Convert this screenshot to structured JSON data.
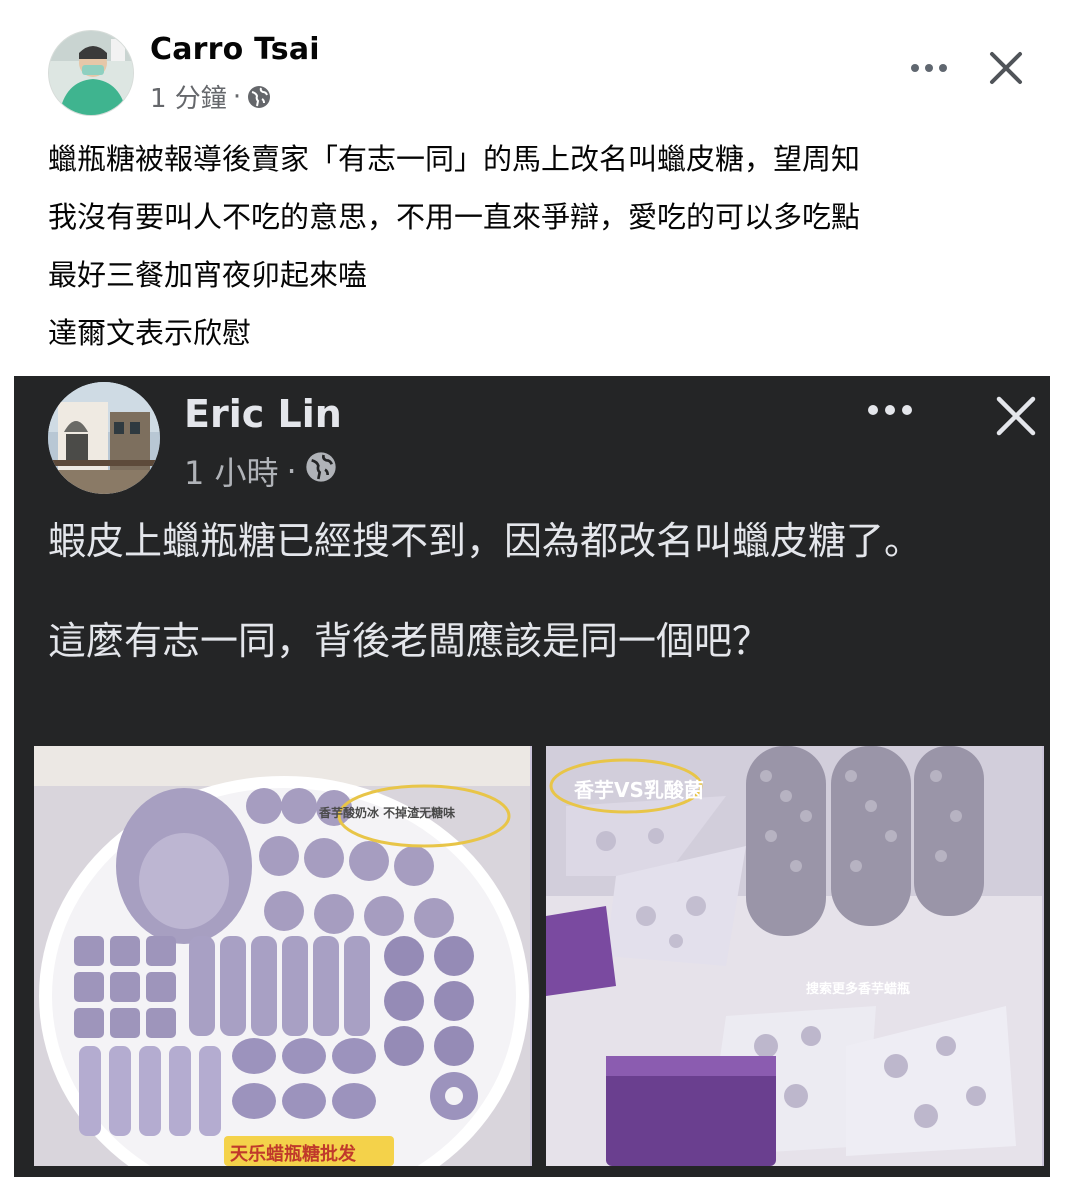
{
  "post": {
    "author": "Carro Tsai",
    "time": "1 分鐘",
    "dot": "·",
    "lines": [
      "蠟瓶糖被報導後賣家「有志一同」的馬上改名叫蠟皮糖，望周知",
      "我沒有要叫人不吃的意思，不用一直來爭辯，愛吃的可以多吃點",
      "最好三餐加宵夜卯起來嗑",
      "達爾文表示欣慰"
    ],
    "icons": {
      "privacy": "globe-icon",
      "more": "more-options-icon",
      "close": "close-icon"
    }
  },
  "shared_post": {
    "author": "Eric Lin",
    "time": "1 小時",
    "dot": "·",
    "text_para1": "蝦皮上蠟瓶糖已經搜不到，因為都改名叫蠟皮糖了。",
    "text_para2": "這麼有志一同，背後老闆應該是同一個吧？",
    "photo_captions": {
      "left_top": "香芋酸奶冰 不掉渣无糖味",
      "left_bottom": "天乐蜡瓶糖批发",
      "right_top": "香芋VS乳酸菌",
      "right_middle": "搜索更多香芋蜡瓶"
    },
    "icons": {
      "privacy": "globe-icon",
      "more": "more-options-icon",
      "close": "close-icon"
    }
  },
  "colors": {
    "dark_card": "#242526",
    "muted": "#65676b",
    "dark_text": "#e4e6eb",
    "candy": "#a89ec0"
  }
}
